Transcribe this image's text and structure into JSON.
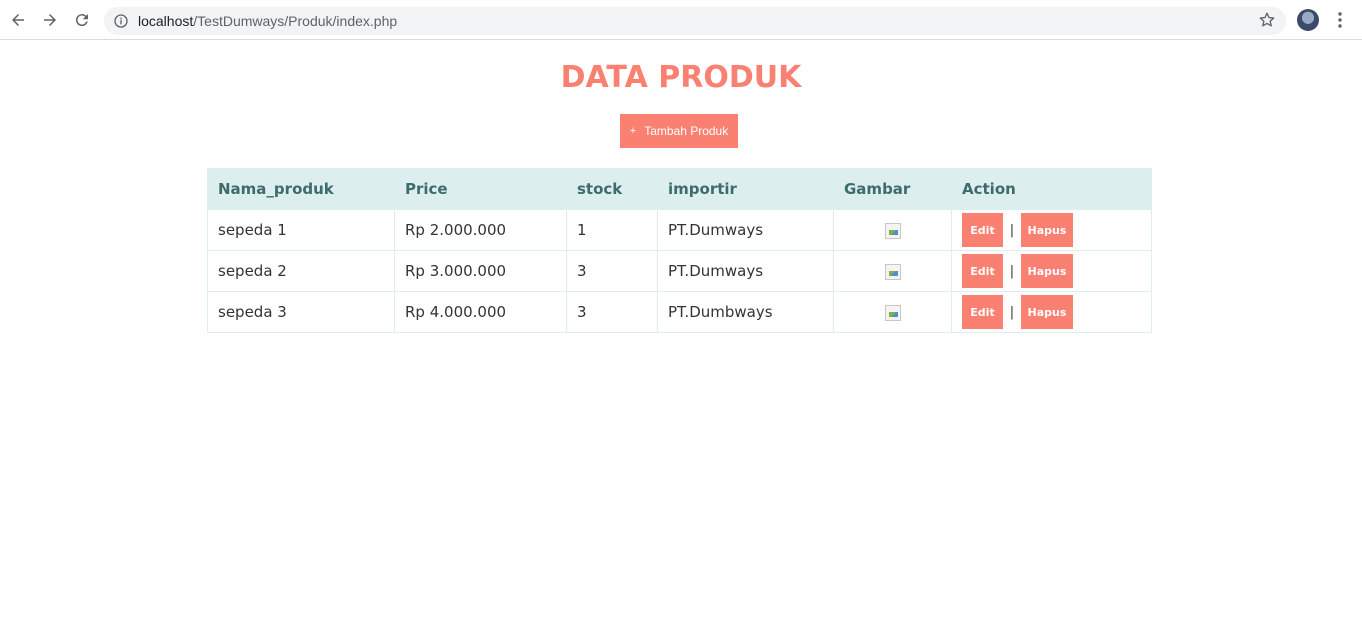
{
  "browser": {
    "url_host": "localhost",
    "url_path": "/TestDumways/Produk/index.php"
  },
  "page": {
    "title": "DATA PRODUK",
    "add_button_icon": "+",
    "add_button_label": "Tambah Produk"
  },
  "table": {
    "headers": [
      "Nama_produk",
      "Price",
      "stock",
      "importir",
      "Gambar",
      "Action"
    ],
    "rows": [
      {
        "nama": "sepeda 1",
        "price": "Rp 2.000.000",
        "stock": "1",
        "importir": "PT.Dumways"
      },
      {
        "nama": "sepeda 2",
        "price": "Rp 3.000.000",
        "stock": "3",
        "importir": "PT.Dumways"
      },
      {
        "nama": "sepeda 3",
        "price": "Rp 4.000.000",
        "stock": "3",
        "importir": "PT.Dumbways"
      }
    ],
    "edit_label": "Edit",
    "hapus_label": "Hapus",
    "separator": "|"
  },
  "colors": {
    "accent": "#fa8072",
    "header_bg": "#dceeee",
    "header_text": "#3e6b6b"
  },
  "icons": [
    "back-arrow-icon",
    "forward-arrow-icon",
    "reload-icon",
    "info-icon",
    "star-icon",
    "more-vert-icon",
    "broken-image-icon"
  ]
}
